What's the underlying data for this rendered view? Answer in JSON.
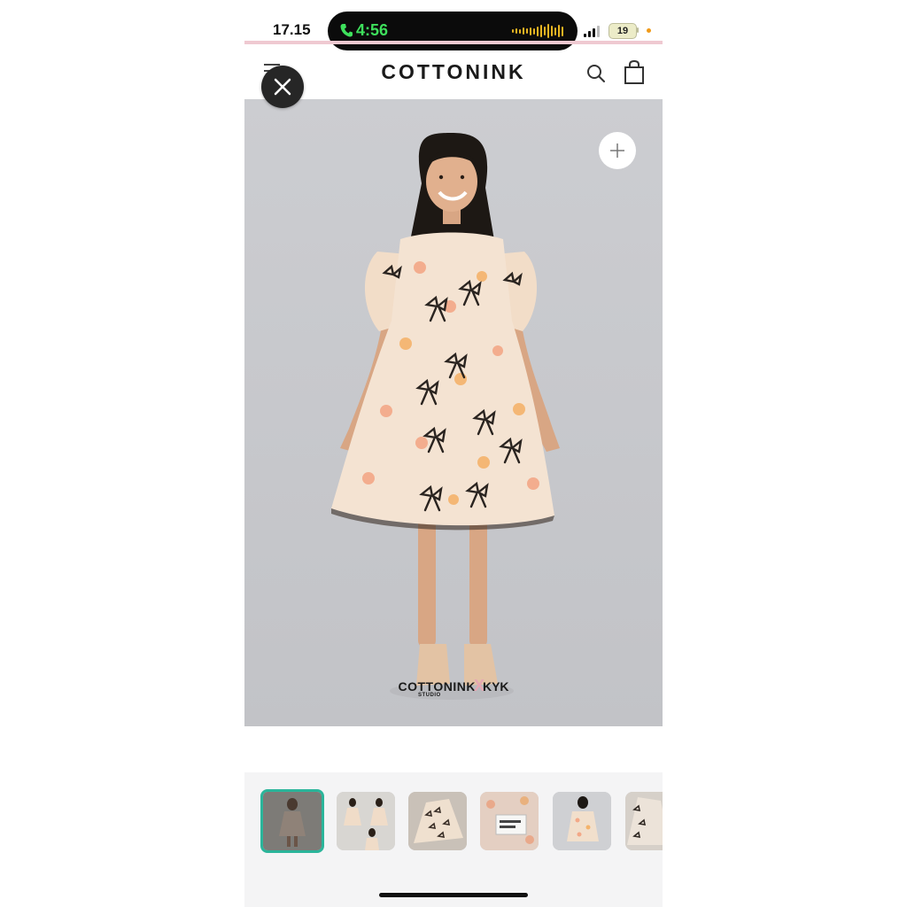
{
  "status_bar": {
    "time": "17.15",
    "call_timer": "4:56",
    "battery_level": "19"
  },
  "header": {
    "brand": "COTTONINK"
  },
  "hero": {
    "collab_left": "COTTONINK",
    "collab_x": "X",
    "collab_right": "KYK",
    "collab_sub": "STUDIO"
  },
  "thumbnails": {
    "count": 6,
    "selected_index": 0
  },
  "colors": {
    "accent_selected": "#2bb59a",
    "call_green": "#3ee05c",
    "pink_bar": "#efc9d1"
  },
  "icons": [
    "phone-icon",
    "waveform-icon",
    "signal-icon",
    "battery-icon",
    "menu-icon",
    "search-icon",
    "bag-icon",
    "close-icon",
    "plus-icon"
  ]
}
